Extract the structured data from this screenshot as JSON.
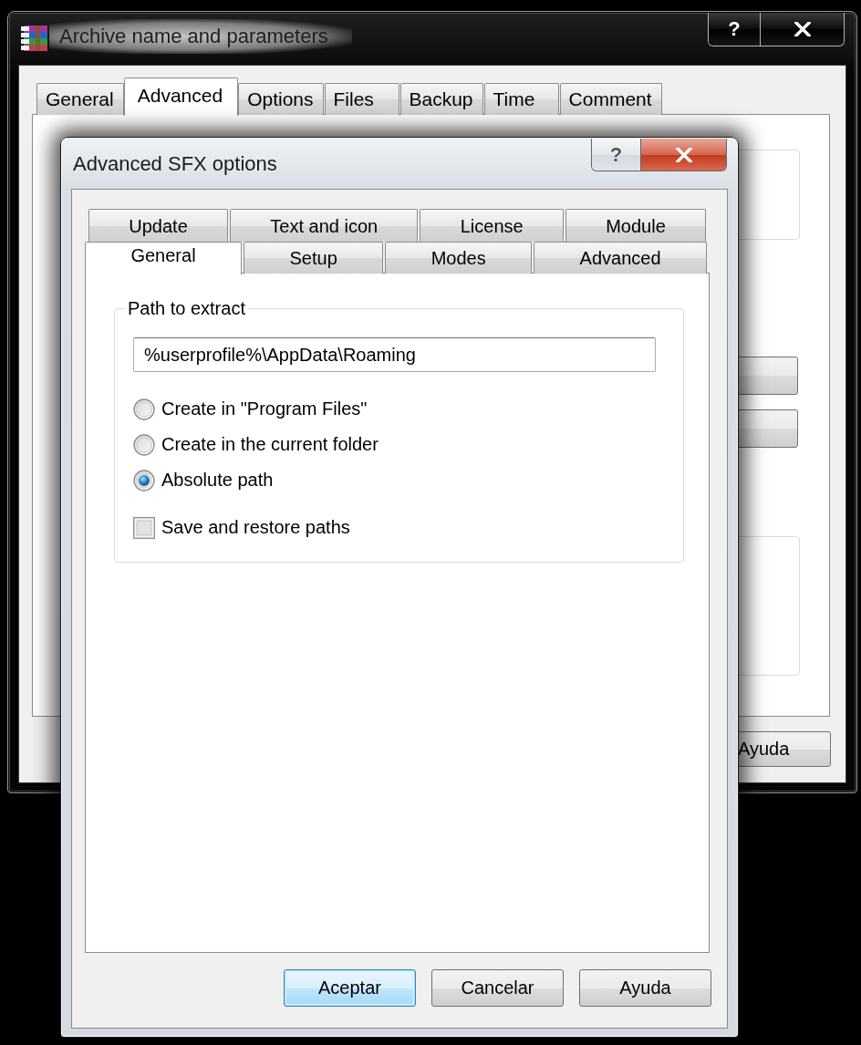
{
  "back_window": {
    "title": "Archive name and parameters",
    "help_label": "?",
    "tabs": [
      {
        "label": "General",
        "selected": false
      },
      {
        "label": "Advanced",
        "selected": true
      },
      {
        "label": "Options",
        "selected": false
      },
      {
        "label": "Files",
        "selected": false
      },
      {
        "label": "Backup",
        "selected": false
      },
      {
        "label": "Time",
        "selected": false
      },
      {
        "label": "Comment",
        "selected": false
      }
    ],
    "buttons": [
      {
        "label": "Ayuda"
      }
    ]
  },
  "dialog": {
    "title": "Advanced SFX options",
    "help_label": "?",
    "tab_rows": [
      {
        "tabs": [
          {
            "label": "Update",
            "selected": false
          },
          {
            "label": "Text and icon",
            "selected": false
          },
          {
            "label": "License",
            "selected": false
          },
          {
            "label": "Module",
            "selected": false
          }
        ]
      },
      {
        "tabs": [
          {
            "label": "General",
            "selected": true
          },
          {
            "label": "Setup",
            "selected": false
          },
          {
            "label": "Modes",
            "selected": false
          },
          {
            "label": "Advanced",
            "selected": false
          }
        ]
      }
    ],
    "path_group": {
      "title": "Path to extract",
      "path_field": {
        "value": "%userprofile%\\AppData\\Roaming"
      },
      "options": [
        {
          "kind": "radio",
          "label": "Create in \"Program Files\"",
          "selected": false
        },
        {
          "kind": "radio",
          "label": "Create in the current folder",
          "selected": false
        },
        {
          "kind": "radio",
          "label": "Absolute path",
          "selected": true
        },
        {
          "kind": "checkbox",
          "label": "Save and restore paths",
          "checked": false
        }
      ]
    },
    "buttons": [
      {
        "label": "Aceptar",
        "default": true
      },
      {
        "label": "Cancelar",
        "default": false
      },
      {
        "label": "Ayuda",
        "default": false
      }
    ]
  }
}
